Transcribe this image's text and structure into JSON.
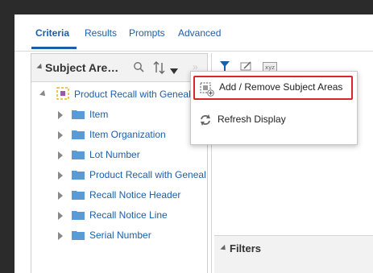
{
  "tabs": [
    {
      "label": "Criteria",
      "active": true
    },
    {
      "label": "Results",
      "active": false
    },
    {
      "label": "Prompts",
      "active": false
    },
    {
      "label": "Advanced",
      "active": false
    }
  ],
  "left_pane": {
    "title": "Subject Are…",
    "icons": [
      "search-icon",
      "sort-icon",
      "dropdown-arrow-icon"
    ],
    "root": {
      "label": "Product Recall with Geneal",
      "icon": "subject-area-icon"
    },
    "folders": [
      "Item",
      "Item Organization",
      "Lot Number",
      "Product Recall with Geneal",
      "Recall Notice Header",
      "Recall Notice Line",
      "Serial Number"
    ]
  },
  "toolbar": {
    "icons": [
      "filter-icon",
      "edit-icon",
      "xml-icon"
    ]
  },
  "menu": {
    "items": [
      {
        "label": "Add / Remove Subject Areas",
        "icon": "add-subject-area-icon",
        "highlighted": true
      },
      {
        "label": "Refresh Display",
        "icon": "refresh-icon",
        "highlighted": false
      }
    ]
  },
  "filters": {
    "label": "Filters"
  },
  "colors": {
    "accent": "#1b5fa8",
    "highlight_border": "#d9262a",
    "folder": "#5b9bd5"
  }
}
